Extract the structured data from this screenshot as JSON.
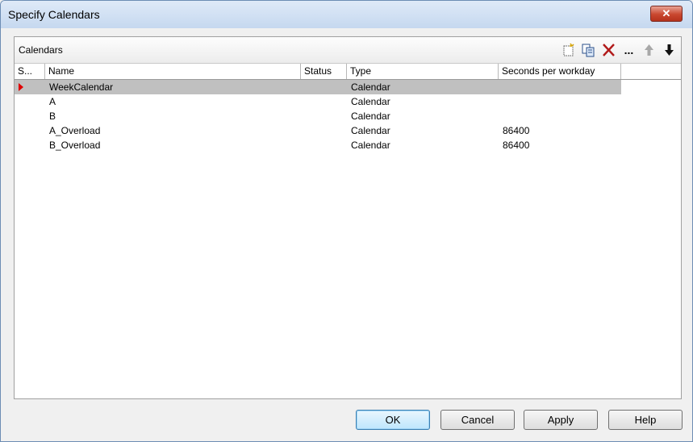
{
  "window": {
    "title": "Specify Calendars",
    "close_label": "✕"
  },
  "panel": {
    "title": "Calendars",
    "toolbar": [
      "new-icon",
      "copy-icon",
      "delete-icon",
      "ellipsis",
      "arrow-up-icon",
      "arrow-down-icon"
    ],
    "ellipsis_label": "..."
  },
  "table": {
    "columns": [
      "S...",
      "Name",
      "Status",
      "Type",
      "Seconds per workday"
    ],
    "rows": [
      {
        "name": "WeekCalendar",
        "status": "",
        "type": "Calendar",
        "seconds": ""
      },
      {
        "name": "A",
        "status": "",
        "type": "Calendar",
        "seconds": ""
      },
      {
        "name": "B",
        "status": "",
        "type": "Calendar",
        "seconds": ""
      },
      {
        "name": "A_Overload",
        "status": "",
        "type": "Calendar",
        "seconds": "86400"
      },
      {
        "name": "B_Overload",
        "status": "",
        "type": "Calendar",
        "seconds": "86400"
      }
    ]
  },
  "buttons": {
    "ok": "OK",
    "cancel": "Cancel",
    "apply": "Apply",
    "help": "Help"
  },
  "colors": {
    "accent": "#3c7fb1",
    "indicator": "#e00000",
    "selected_row": "#c0c0c0"
  }
}
